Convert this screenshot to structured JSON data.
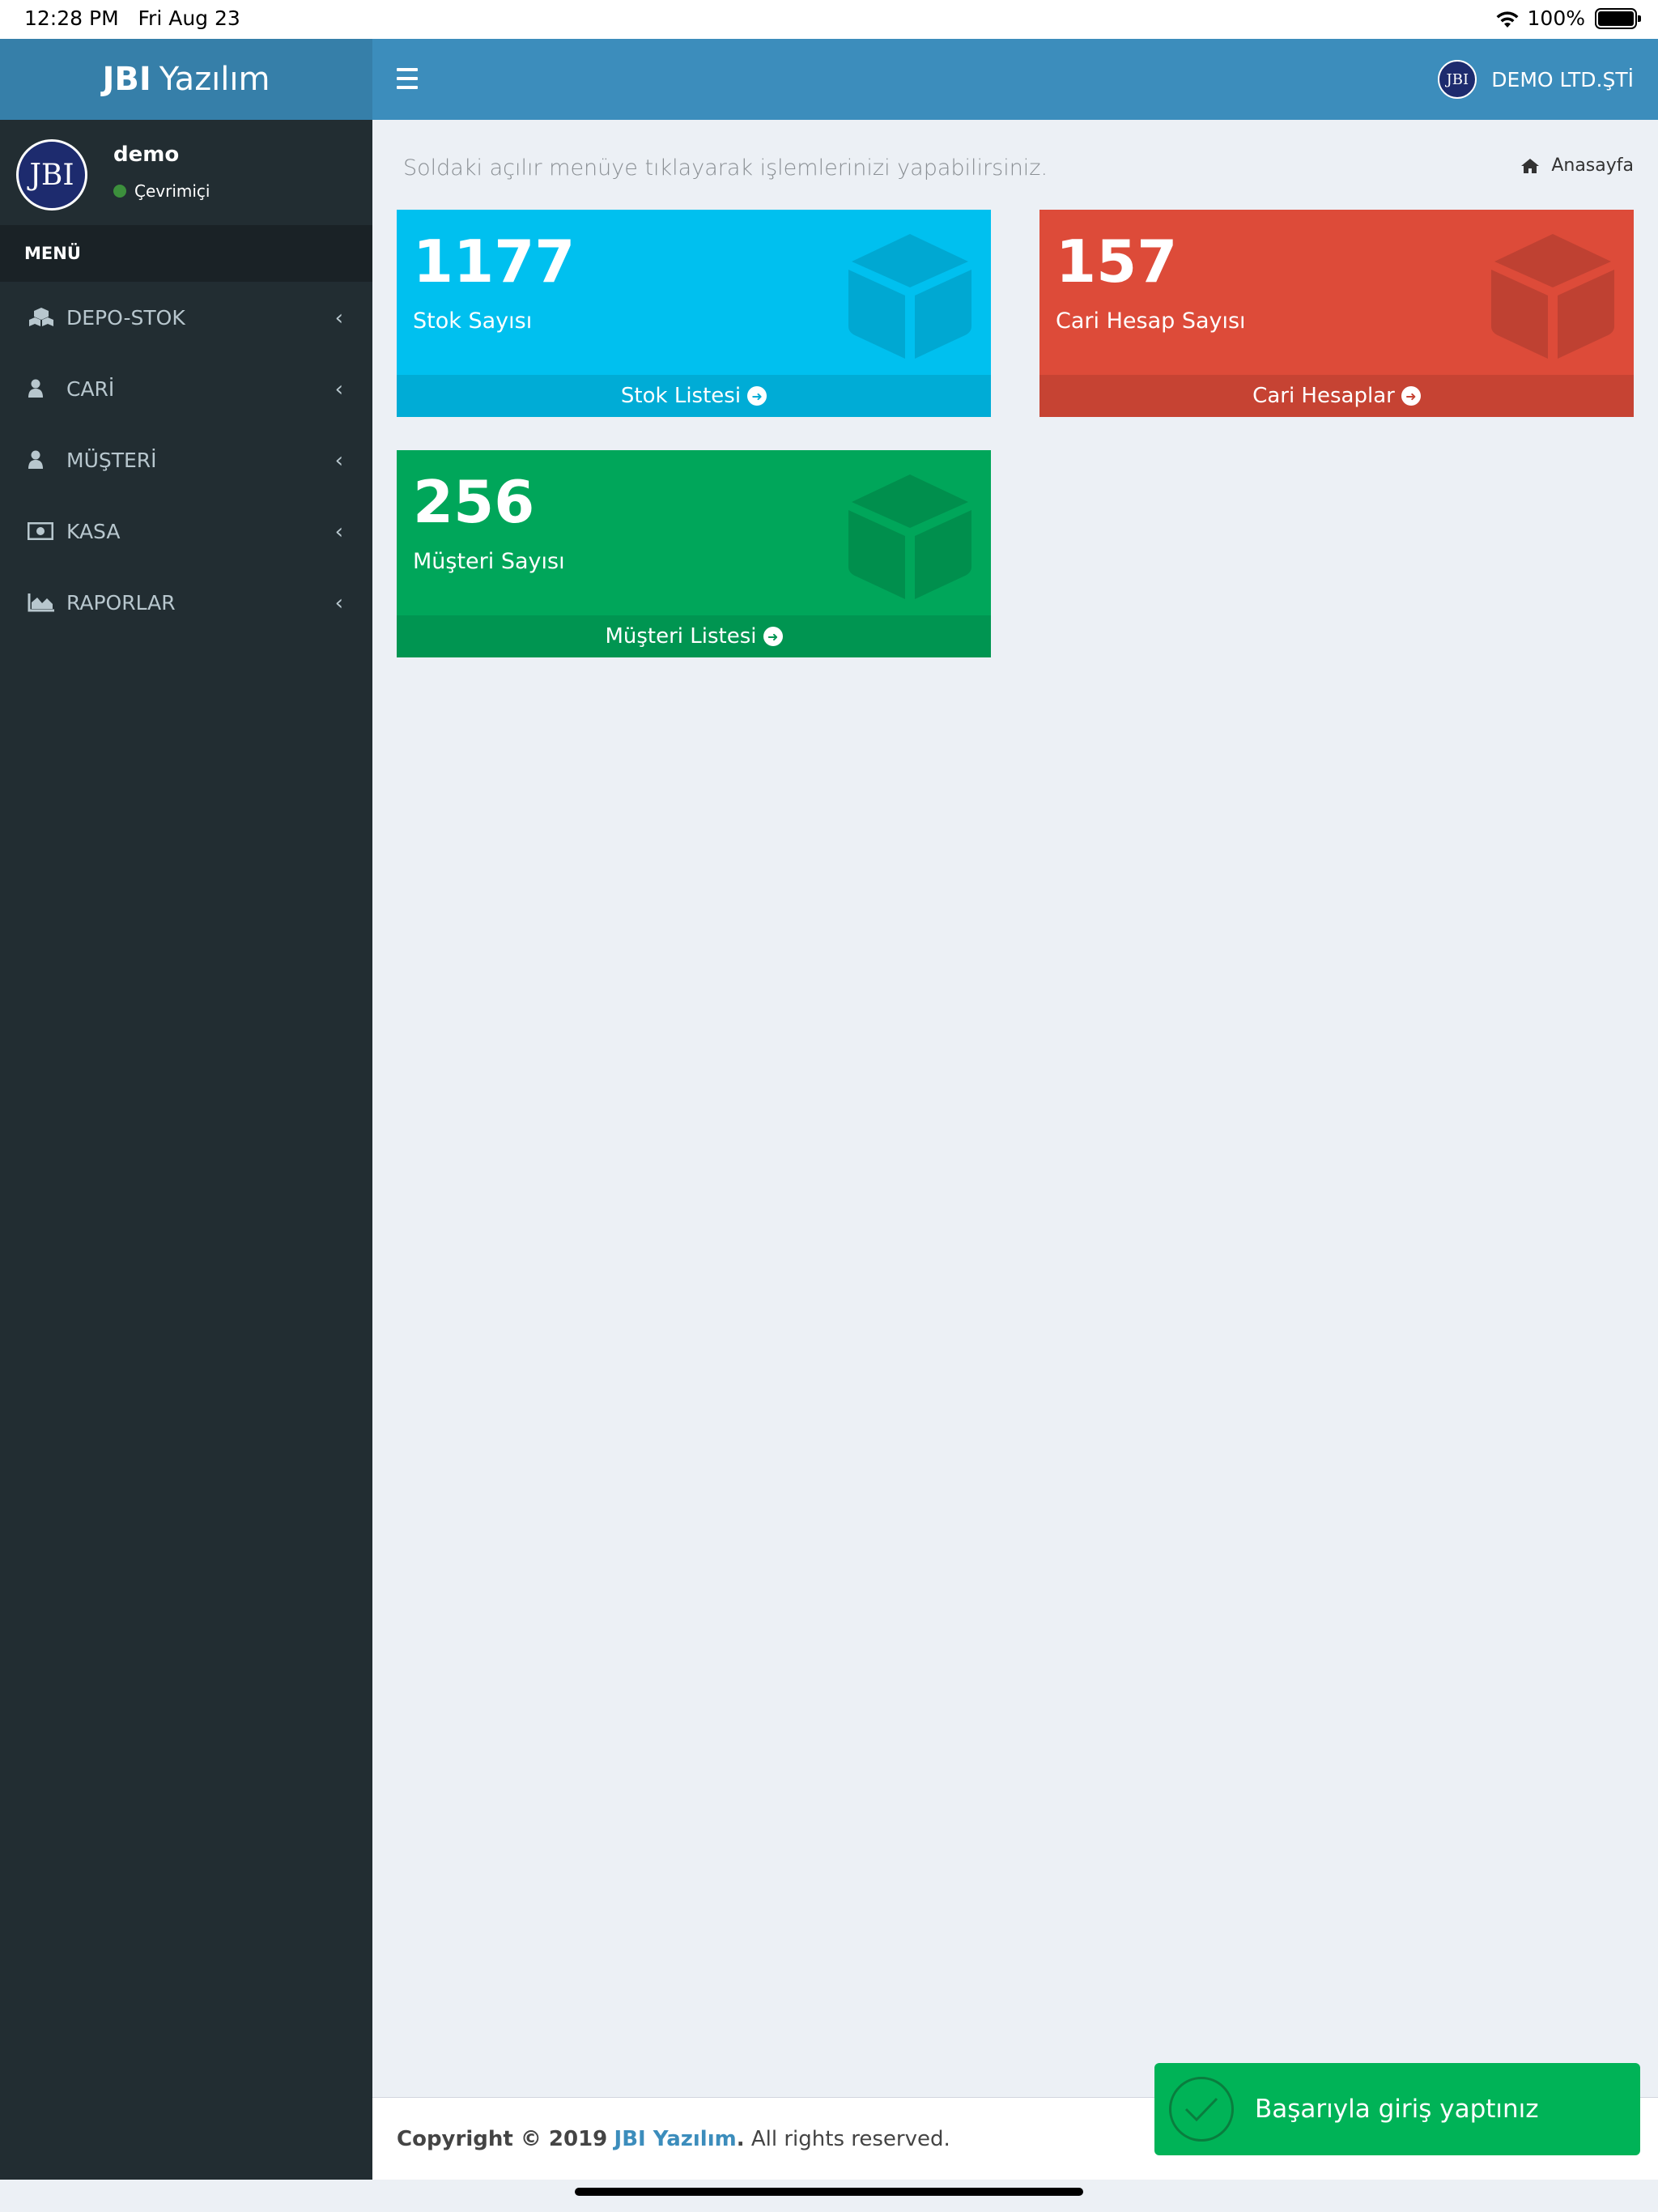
{
  "status_bar": {
    "time": "12:28 PM",
    "date": "Fri Aug 23",
    "battery": "100%"
  },
  "header": {
    "brand_bold": "JBI",
    "brand_rest": "Yazılım",
    "company": "DEMO LTD.ŞTİ",
    "logo_text": "JBI"
  },
  "sidebar": {
    "user_name": "demo",
    "user_status": "Çevrimiçi",
    "menu_header": "MENÜ",
    "items": [
      {
        "label": "DEPO-STOK",
        "icon": "cubes-icon"
      },
      {
        "label": "CARİ",
        "icon": "user-icon"
      },
      {
        "label": "MÜŞTERİ",
        "icon": "user-icon"
      },
      {
        "label": "KASA",
        "icon": "money-icon"
      },
      {
        "label": "RAPORLAR",
        "icon": "area-chart-icon"
      }
    ]
  },
  "content": {
    "subtitle": "Soldaki açılır menüye tıklayarak işlemlerinizi yapabilirsiniz.",
    "breadcrumb": "Anasayfa",
    "boxes": [
      {
        "value": "1177",
        "label": "Stok Sayısı",
        "link": "Stok Listesi",
        "color": "#00c0ef"
      },
      {
        "value": "157",
        "label": "Cari Hesap Sayısı",
        "link": "Cari Hesaplar",
        "color": "#dd4b39"
      },
      {
        "value": "256",
        "label": "Müşteri Sayısı",
        "link": "Müşteri Listesi",
        "color": "#00a65a"
      }
    ]
  },
  "footer": {
    "copyright_prefix": "Copyright © 2019",
    "brand": "JBI Yazılım",
    "suffix": "All rights reserved."
  },
  "toast": {
    "message": "Başarıyla giriş yaptınız"
  }
}
